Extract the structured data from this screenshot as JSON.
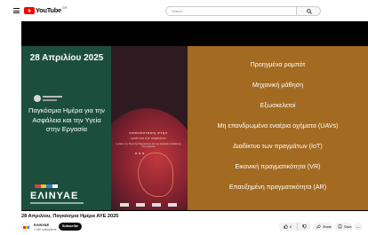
{
  "header": {
    "logo_text": "YouTube",
    "logo_cc": "GR",
    "search_placeholder": "Search"
  },
  "video": {
    "left_panel": {
      "date": "28 Απριλίου 2025",
      "day_title": "Παγκόσμια Ημέρα για την Ασφάλεια και την Υγεία στην Εργασία",
      "org": "ΕΛΙΝΥΑΕ",
      "bar_colors": [
        "#e23b3b",
        "#f2c31a",
        "#2b7fd4",
        "#ffffff"
      ]
    },
    "center_poster": {
      "title": "επανάσταση στην",
      "title2": "υγεία και την ασφάλεια:",
      "desc": "ο ρόλος της Τεχνητής Νοημοσύνης και της ψηφιακής μετάβασης στην εργασία"
    },
    "topics": [
      "Προηγμένα ρομπότ",
      "Μηχανική μάθηση",
      "Εξωσκελετοί",
      "Μη επανδρωμένα εναέρια οχήματα (UAVs)",
      "Διαδίκτυο των πραγμάτων (IoT)",
      "Εικονική πραγματικότητα (VR)",
      "Επαυξημένη πραγματικότητα (AR)"
    ]
  },
  "meta": {
    "title": "28 Απριλίου, Παγκόσμια Ημέρα ΑΥΕ 2025",
    "channel_name": "ΕΛΙΝΥΑΕ",
    "channel_subs": "2.04K subscribers",
    "subscribe_label": "Subscribe",
    "like_count": "6",
    "share_label": "Share",
    "save_label": "Save",
    "more_label": "..."
  }
}
